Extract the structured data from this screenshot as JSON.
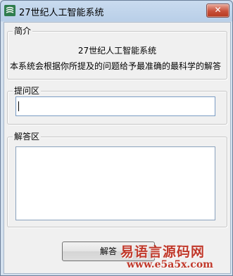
{
  "window": {
    "title": "27世纪人工智能系统",
    "close_symbol": "✕",
    "icon": "app-logo-icon"
  },
  "intro": {
    "legend": "简介",
    "title": "27世纪人工智能系统",
    "description": "本系统会根据你所提及的问题给予最准确的最科学的解答"
  },
  "question": {
    "legend": "提问区",
    "value": ""
  },
  "answer": {
    "legend": "解答区",
    "value": ""
  },
  "actions": {
    "answer_button": "解答"
  },
  "watermark": {
    "title": "易语言源码网",
    "url": "www.e5a5x.com"
  },
  "colors": {
    "title_bar": "#b9cfe8",
    "client_bg": "#f0f0f0",
    "close_button": "#c8503a",
    "watermark": "#c0392b"
  }
}
